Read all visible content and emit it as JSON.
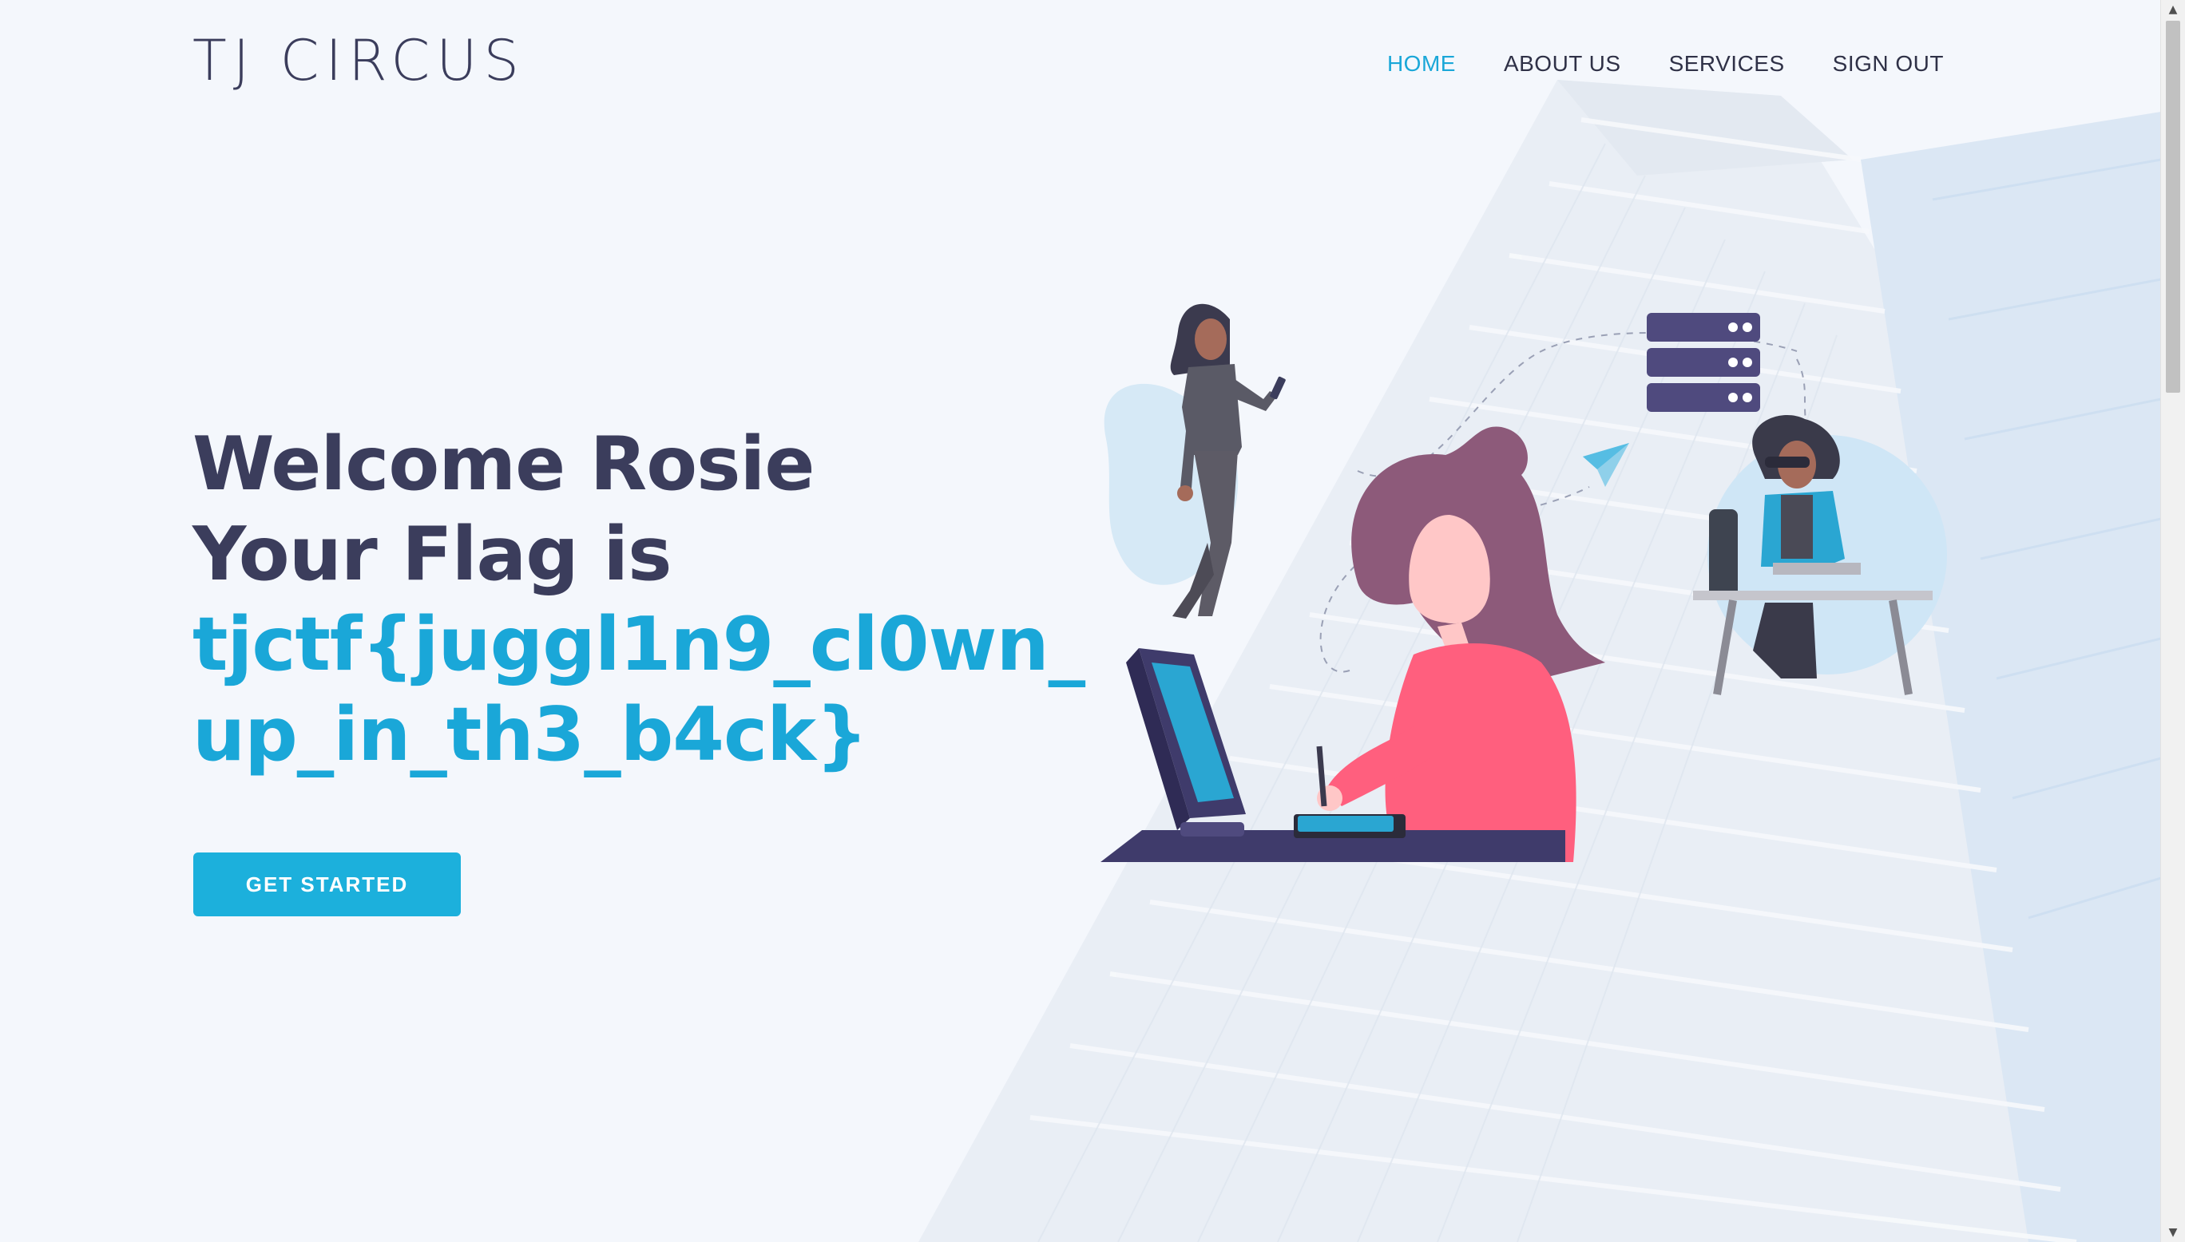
{
  "header": {
    "logo": "TJ CIRCUS",
    "nav": [
      {
        "label": "HOME",
        "active": true
      },
      {
        "label": "ABOUT US",
        "active": false
      },
      {
        "label": "SERVICES",
        "active": false
      },
      {
        "label": "SIGN OUT",
        "active": false
      }
    ]
  },
  "hero": {
    "line1": "Welcome Rosie",
    "line2": "Your Flag is",
    "flag": "tjctf{juggl1n9_cl0wn_up_in_th3_b4ck}",
    "cta_label": "GET STARTED"
  },
  "colors": {
    "accent": "#1aa7d8",
    "heading": "#3b3d5c",
    "background": "#f4f7fc"
  }
}
